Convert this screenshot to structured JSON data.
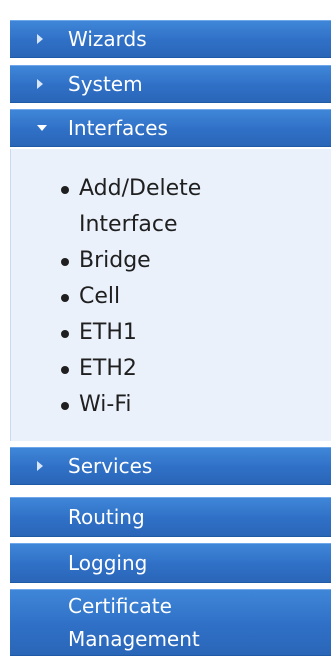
{
  "nav": {
    "wizards": {
      "label": "Wizards",
      "icon": "chevron-right-icon"
    },
    "system": {
      "label": "System",
      "icon": "chevron-right-icon"
    },
    "interfaces": {
      "label": "Interfaces",
      "icon": "chevron-down-icon",
      "expanded": true,
      "items": [
        {
          "label": "Add/Delete Interface"
        },
        {
          "label": "Bridge"
        },
        {
          "label": "Cell"
        },
        {
          "label": "ETH1"
        },
        {
          "label": "ETH2"
        },
        {
          "label": "Wi-Fi"
        }
      ]
    },
    "services": {
      "label": "Services",
      "icon": "chevron-right-icon"
    },
    "routing": {
      "label": "Routing"
    },
    "logging": {
      "label": "Logging"
    },
    "certificate_management": {
      "label": "Certificate Management"
    }
  },
  "colors": {
    "nav_bg": "#2f70c6",
    "nav_text": "#ffffff",
    "submenu_bg": "#eaf1fb",
    "submenu_text": "#1f1f1f"
  }
}
